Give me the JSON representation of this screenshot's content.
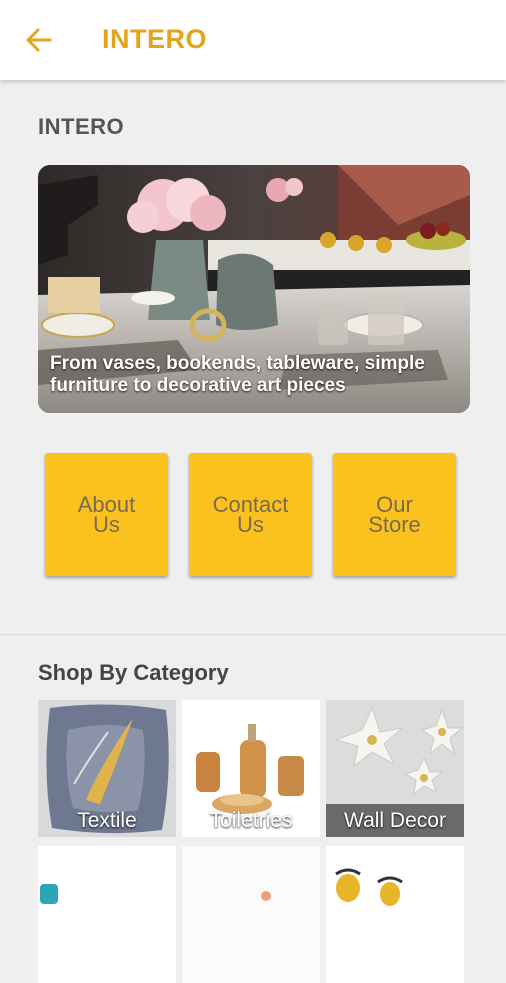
{
  "appbar": {
    "title": "INTERO",
    "back_icon": "arrow-left-icon",
    "accent_color": "#e3a41b"
  },
  "section": {
    "label": "INTERO"
  },
  "banner": {
    "caption": "From vases, bookends, tableware, simple furniture to decorative art pieces"
  },
  "nav_buttons": [
    {
      "label": "About Us"
    },
    {
      "label": "Contact Us"
    },
    {
      "label": "Our Store"
    }
  ],
  "nav_button_color": "#fbc21d",
  "shop": {
    "heading": "Shop By Category",
    "categories": [
      {
        "label": "Textile"
      },
      {
        "label": "Toiletries"
      },
      {
        "label": "Wall Decor"
      }
    ]
  }
}
